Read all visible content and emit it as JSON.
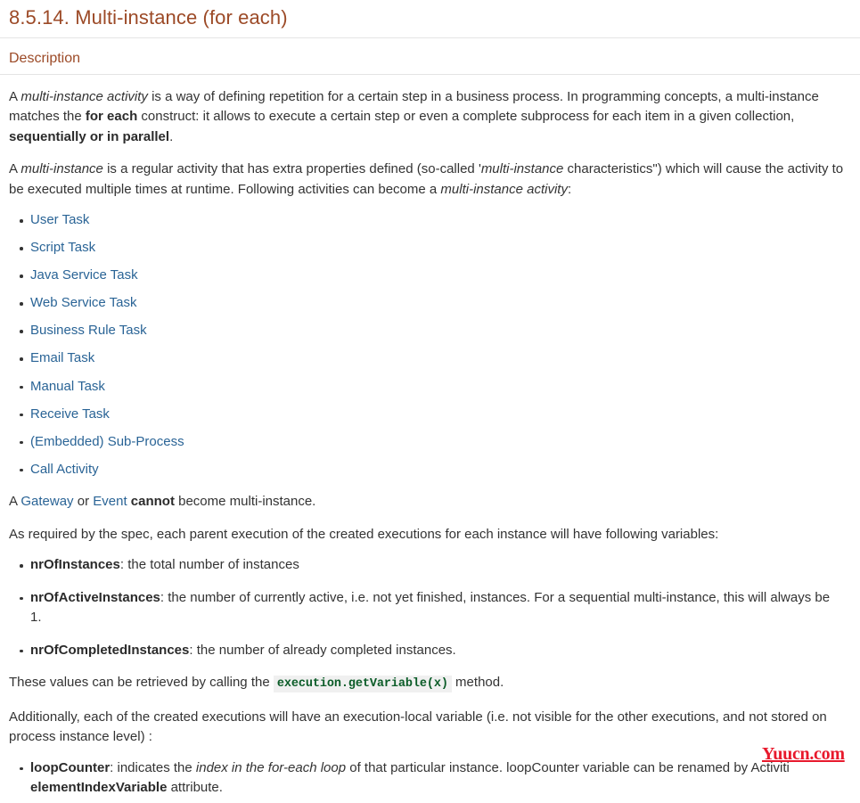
{
  "document": {
    "chapter_heading": "8.5.14. Multi-instance (for each)",
    "section_heading": "Description",
    "paragraph_1": {
      "part_1": "A ",
      "em_1": "multi-instance activity",
      "part_2": " is a way of defining repetition for a certain step in a business process. In programming concepts, a multi-instance matches the ",
      "strong_1": "for each",
      "part_3": " construct: it allows to execute a certain step or even a complete subprocess for each item in a given collection, ",
      "strong_2": "sequentially or in parallel",
      "part_4": "."
    },
    "paragraph_2": {
      "part_1": "A ",
      "em_1": "multi-instance",
      "part_2": " is a regular activity that has extra properties defined (so-called '",
      "em_2": "multi-instance",
      "part_3": " characteristics\") which will cause the activity to be executed multiple times at runtime. Following activities can become a ",
      "em_3": "multi-instance activity",
      "part_4": ":"
    },
    "activity_links": [
      "User Task",
      "Script Task",
      "Java Service Task",
      "Web Service Task",
      "Business Rule Task",
      "Email Task",
      "Manual Task",
      "Receive Task",
      "(Embedded) Sub-Process",
      "Call Activity"
    ],
    "paragraph_3": {
      "part_1": "A ",
      "link_1": "Gateway",
      "part_2": " or ",
      "link_2": "Event",
      "part_3": " ",
      "strong_1": "cannot",
      "part_4": " become multi-instance."
    },
    "paragraph_4": "As required by the spec, each parent execution of the created executions for each instance will have following variables:",
    "variables": [
      {
        "name": "nrOfInstances",
        "description": ": the total number of instances"
      },
      {
        "name": "nrOfActiveInstances",
        "description": ": the number of currently active, i.e. not yet finished, instances. For a sequential multi-instance, this will always be 1."
      },
      {
        "name": "nrOfCompletedInstances",
        "description": ": the number of already completed instances."
      }
    ],
    "paragraph_5": {
      "part_1": "These values can be retrieved by calling the ",
      "code": "execution.getVariable(x)",
      "part_2": " method."
    },
    "paragraph_6": "Additionally, each of the created executions will have an execution-local variable (i.e. not visible for the other executions, and not stored on process instance level) :",
    "loop_counter": {
      "name": "loopCounter",
      "part_1": ": indicates the ",
      "em_1": "index in the for-each loop",
      "part_2": " of that particular instance. loopCounter variable can be renamed by Activiti ",
      "strong_2": "elementIndexVariable",
      "part_3": " attribute."
    },
    "watermark": "Yuucn.com",
    "colors": {
      "heading": "#9c4a27",
      "link": "#2a6496",
      "body_text": "#333333",
      "code_text": "#0b5c28",
      "code_background": "#f0f0f0",
      "rule": "#e4e4e4",
      "watermark": "#e8192c"
    }
  }
}
